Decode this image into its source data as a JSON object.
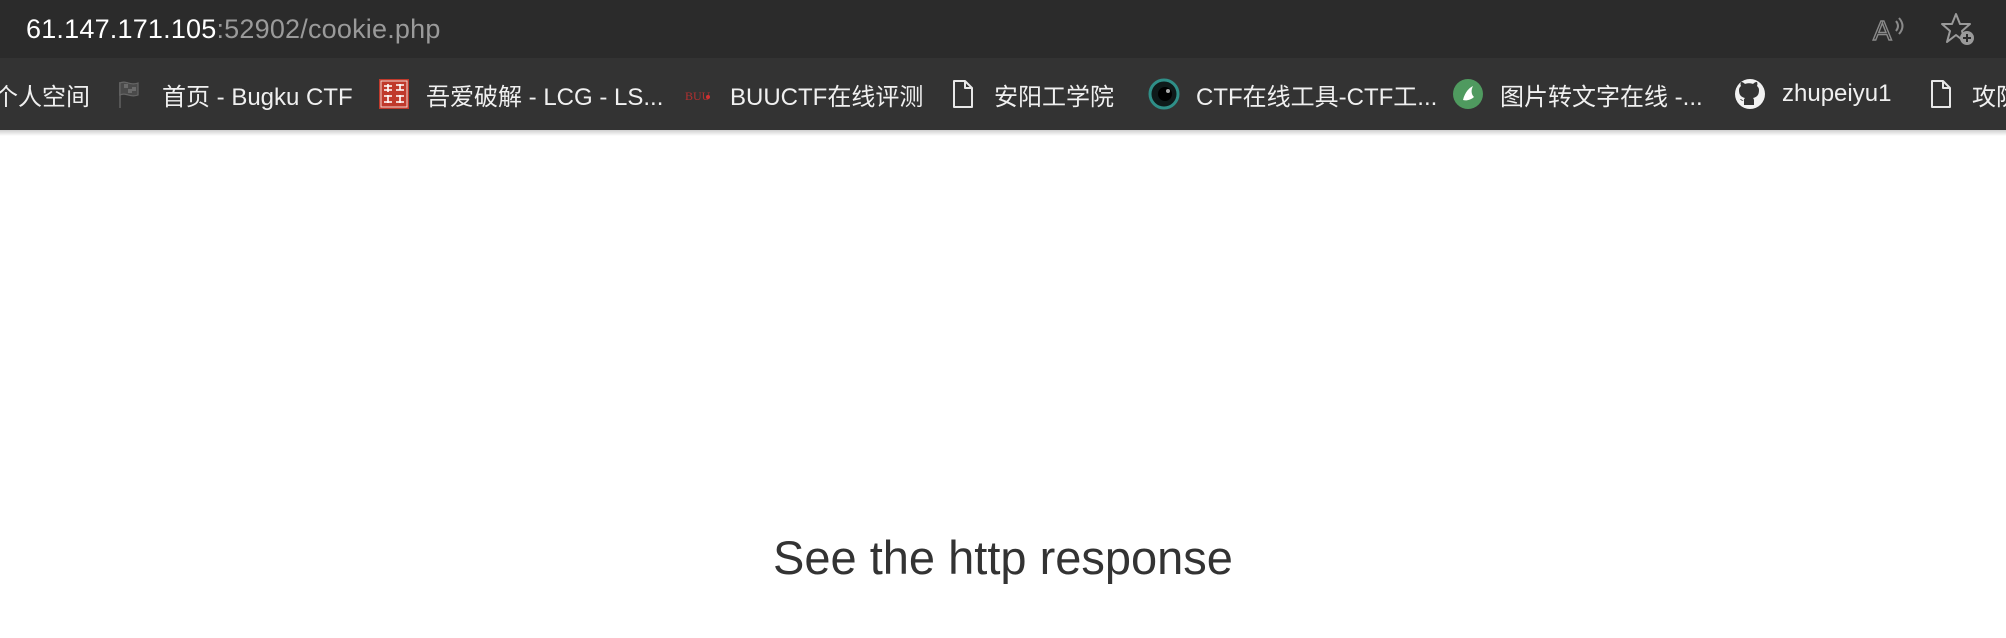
{
  "address_bar": {
    "url_host": "61.147.171.105",
    "url_rest": ":52902/cookie.php",
    "read_aloud_icon": "read-aloud-icon",
    "favorite_icon": "add-favorite-icon"
  },
  "bookmarks": [
    {
      "label": "个人空间",
      "icon": "none"
    },
    {
      "label": "首页 - Bugku CTF",
      "icon": "flag-icon"
    },
    {
      "label": "吾爱破解 - LCG - LS...",
      "icon": "52pojie-icon"
    },
    {
      "label": "BUUCTF在线评测",
      "icon": "buuctf-icon"
    },
    {
      "label": "安阳工学院",
      "icon": "page-icon"
    },
    {
      "label": "CTF在线工具-CTF工...",
      "icon": "eye-icon"
    },
    {
      "label": "图片转文字在线 -...",
      "icon": "green-circle-icon"
    },
    {
      "label": "zhupeiyu1",
      "icon": "github-icon"
    },
    {
      "label": "攻防",
      "icon": "page-icon"
    }
  ],
  "page": {
    "message": "See the http response"
  },
  "colors": {
    "address_bar_bg": "#2b2b2b",
    "bookmarks_bar_bg": "#333333",
    "page_bg": "#ffffff",
    "message_color": "#333333"
  }
}
